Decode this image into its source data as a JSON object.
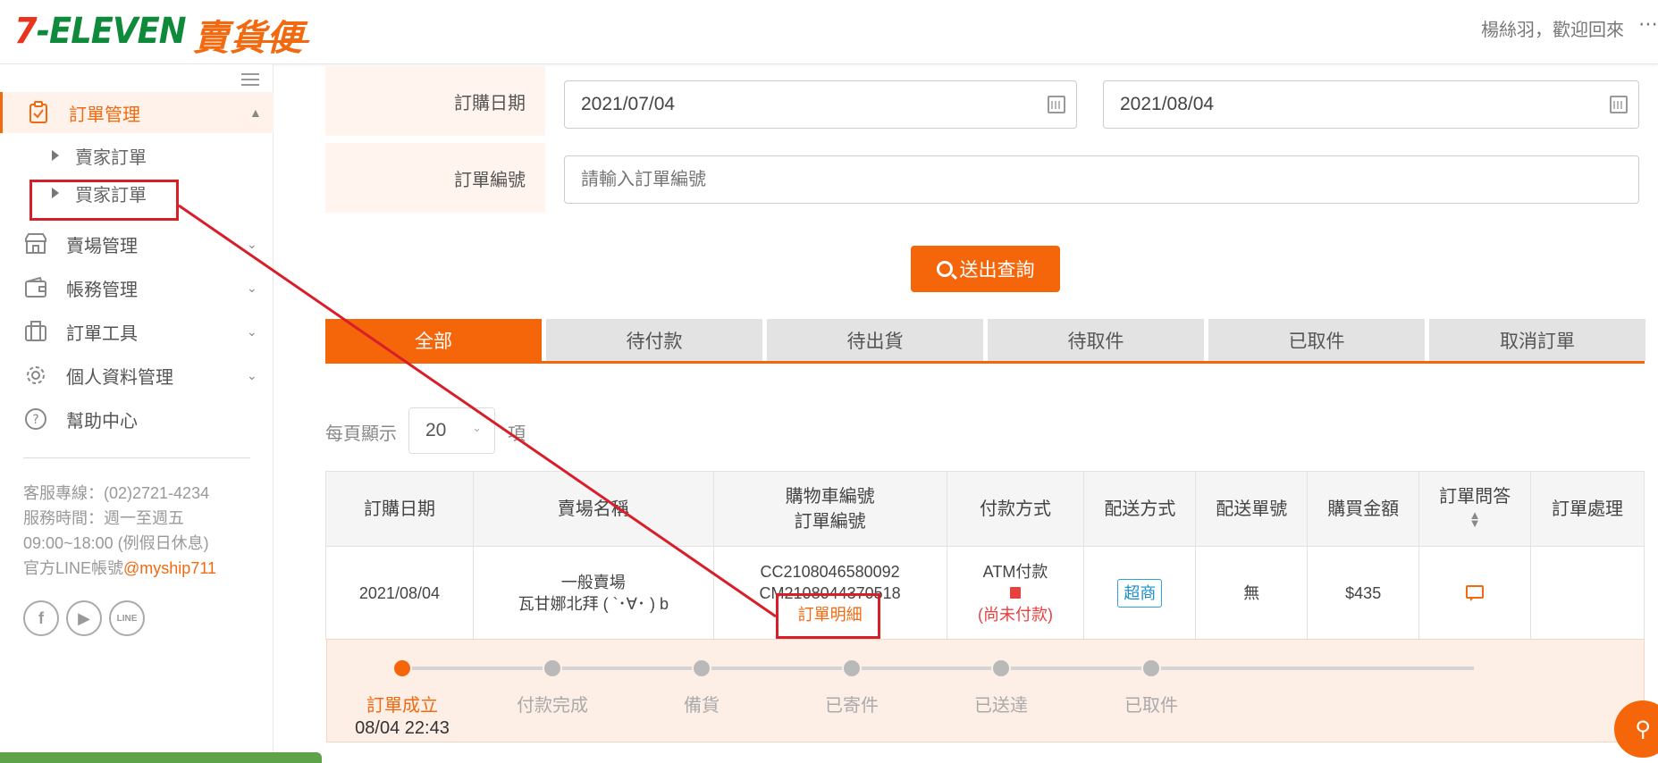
{
  "header": {
    "brand": "7-ELEVEN",
    "brand_sub": "賣貨便",
    "user_greeting": "楊絲羽，歡迎回來",
    "more_icon": "⋯"
  },
  "sidebar": {
    "menu": [
      {
        "label": "訂單管理",
        "icon": "clipboard-check-icon",
        "expanded": true
      },
      {
        "label": "賣場管理",
        "icon": "store-icon"
      },
      {
        "label": "帳務管理",
        "icon": "wallet-icon"
      },
      {
        "label": "訂單工具",
        "icon": "briefcase-icon"
      },
      {
        "label": "個人資料管理",
        "icon": "gear-icon"
      },
      {
        "label": "幫助中心",
        "icon": "question-circle-icon"
      }
    ],
    "submenu": [
      {
        "label": "賣家訂單"
      },
      {
        "label": "買家訂單"
      }
    ],
    "contact": {
      "hotline": "客服專線：(02)2721-4234",
      "hours_label": "服務時間：週一至週五",
      "hours": "09:00~18:00 (例假日休息)",
      "line_label": "官方LINE帳號",
      "line_id": "@myship711"
    },
    "social": [
      "f",
      "▶",
      "LINE"
    ]
  },
  "search": {
    "order_date_label": "訂購日期",
    "date_from": "2021/07/04",
    "date_to": "2021/08/04",
    "order_no_label": "訂單編號",
    "order_no_placeholder": "請輸入訂單編號",
    "submit_label": "送出查詢"
  },
  "tabs": [
    "全部",
    "待付款",
    "待出貨",
    "待取件",
    "已取件",
    "取消訂單"
  ],
  "active_tab": "全部",
  "pagination": {
    "per_page_label": "每頁顯示",
    "per_page_value": "20",
    "per_page_unit": "項"
  },
  "table": {
    "headers": {
      "order_date": "訂購日期",
      "store_name": "賣場名稱",
      "cart_no": "購物車編號",
      "order_no": "訂單編號",
      "payment": "付款方式",
      "shipping": "配送方式",
      "tracking": "配送單號",
      "amount": "購買金額",
      "qa": "訂單問答",
      "action": "訂單處理"
    },
    "rows": [
      {
        "order_date": "2021/08/04",
        "store_type": "一般賣場",
        "store_name": "瓦甘娜北拜 ( `･∀･ ) b",
        "cart_no": "CC2108046580092",
        "order_no": "CM2108044370518",
        "detail_link": "訂單明細",
        "payment": "ATM付款",
        "payment_status": "(尚未付款)",
        "shipping": "超商",
        "tracking": "無",
        "amount": "$435"
      }
    ]
  },
  "progress": {
    "steps": [
      {
        "label": "訂單成立",
        "time": "08/04 22:43",
        "done": true
      },
      {
        "label": "付款完成",
        "time": "",
        "done": false
      },
      {
        "label": "備貨",
        "time": "",
        "done": false
      },
      {
        "label": "已寄件",
        "time": "",
        "done": false
      },
      {
        "label": "已送達",
        "time": "",
        "done": false
      },
      {
        "label": "已取件",
        "time": "",
        "done": false
      }
    ]
  },
  "colors": {
    "accent": "#f5660b",
    "brand_green": "#0f8a3a",
    "annotation_red": "#d81e2a",
    "tab_inactive": "#e3e3e3"
  }
}
